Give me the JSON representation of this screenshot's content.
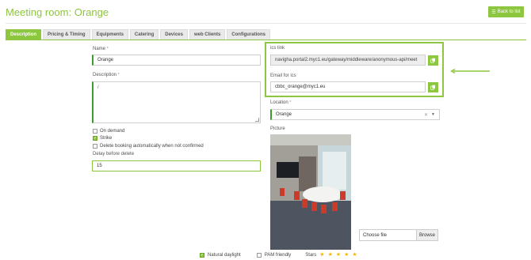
{
  "page": {
    "title": "Meeting room: Orange"
  },
  "header": {
    "back_label": "Back to list"
  },
  "tabs": [
    {
      "label": "Description",
      "active": true
    },
    {
      "label": "Pricing & Timing",
      "active": false
    },
    {
      "label": "Equipments",
      "active": false
    },
    {
      "label": "Catering",
      "active": false
    },
    {
      "label": "Devices",
      "active": false
    },
    {
      "label": "web Clients",
      "active": false
    },
    {
      "label": "Configurations",
      "active": false
    }
  ],
  "form": {
    "name": {
      "label": "Name",
      "required_mark": "*",
      "value": "Orange"
    },
    "description": {
      "label": "Description",
      "required_mark": "*",
      "value": "/"
    },
    "on_demand": {
      "label": "On demand",
      "checked": false
    },
    "strike": {
      "label": "Strike",
      "checked": true
    },
    "delete_booking": {
      "label": "Delete booking automatically when not confirmed",
      "checked": false
    },
    "delay": {
      "label": "Delay before delete",
      "value": "15"
    }
  },
  "ics": {
    "link_label": "ics link",
    "link_value": "navigha.portal2.myc1.eu/gateway/middleware/anonymous-api/meet",
    "email_label": "Email for ics",
    "email_value": "cbbc_orange@myc1.eu"
  },
  "location": {
    "label": "Location",
    "required_mark": "*",
    "value": "Orange"
  },
  "picture": {
    "label": "Picture",
    "choose_file": "Choose file",
    "browse": "Browse"
  },
  "footer": {
    "natural_daylight": {
      "label": "Natural daylight",
      "checked": true
    },
    "pam_friendly": {
      "label": "PAM friendly",
      "checked": false
    },
    "stars_label": "Stars",
    "stars": 5
  },
  "colors": {
    "accent": "#8dc63f",
    "required_border": "#3e9a2e",
    "star": "#f5b800"
  }
}
